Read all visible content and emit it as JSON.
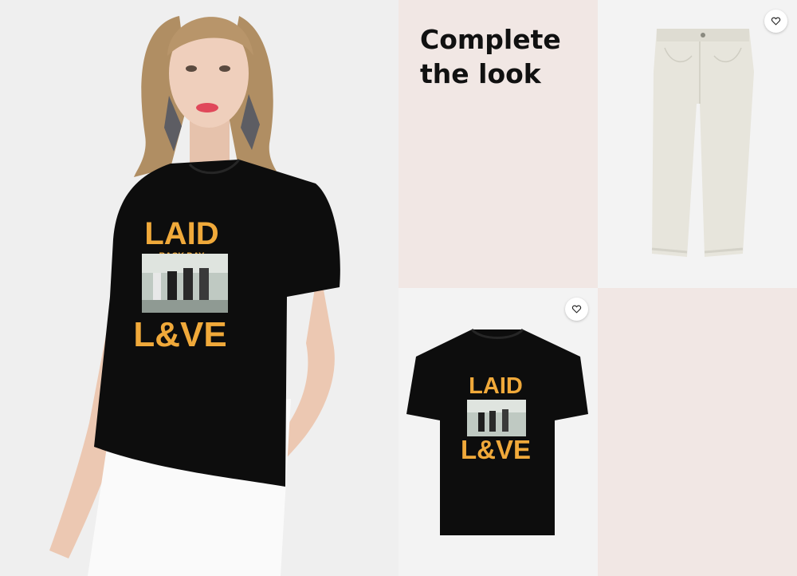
{
  "title": {
    "line1": "Complete",
    "line2": "the look"
  },
  "graphic": {
    "top": "LAID",
    "middle": "BACK DAY",
    "bottom": "L&VE"
  },
  "icons": {
    "wishlist": "heart-outline-icon"
  },
  "colors": {
    "pink_tile": "#f1e7e4",
    "gray_tile": "#f3f3f3",
    "print": "#f0a93a",
    "shirt": "#0d0d0d"
  }
}
